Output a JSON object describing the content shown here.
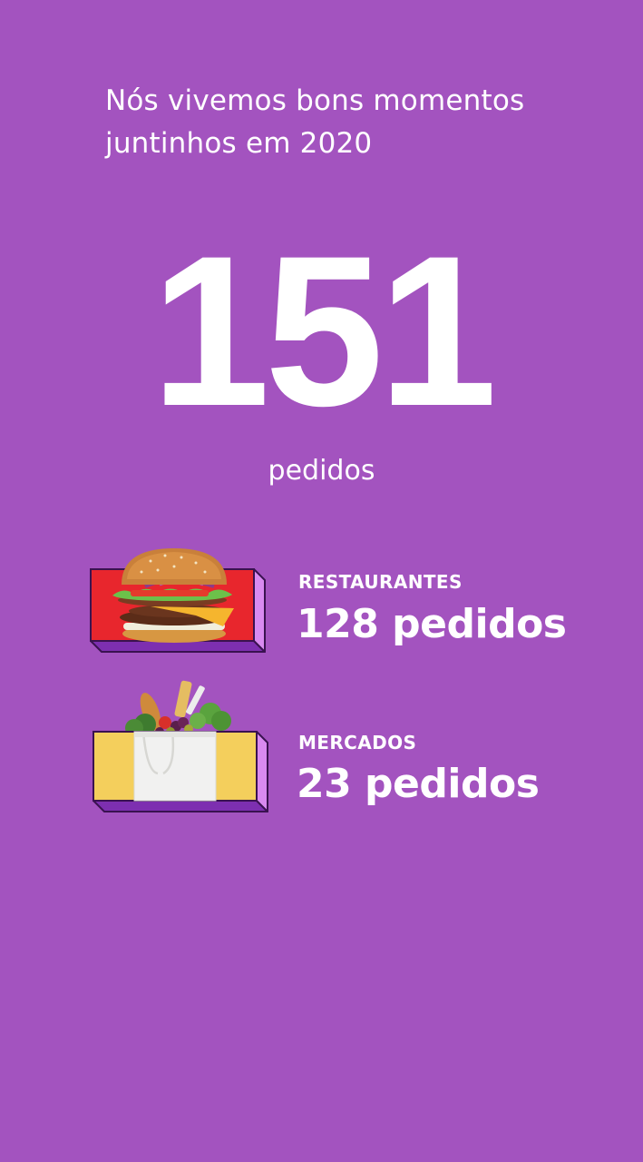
{
  "theme": {
    "background": "#a353bf",
    "box_front_restaurants": "#e8262d",
    "box_front_markets": "#f4cf5c",
    "box_side": "#d98af0",
    "box_bottom": "#7d2fb0",
    "box_outline": "#3a1250"
  },
  "intro": {
    "line1": "Nós vivemos bons momentos",
    "line2": "juntinhos em 2020"
  },
  "total": {
    "number": "151",
    "unit": "pedidos"
  },
  "stats": [
    {
      "icon": "burger-icon",
      "label": "RESTAURANTES",
      "value": "128 pedidos"
    },
    {
      "icon": "grocery-bag-icon",
      "label": "MERCADOS",
      "value": "23 pedidos"
    }
  ]
}
